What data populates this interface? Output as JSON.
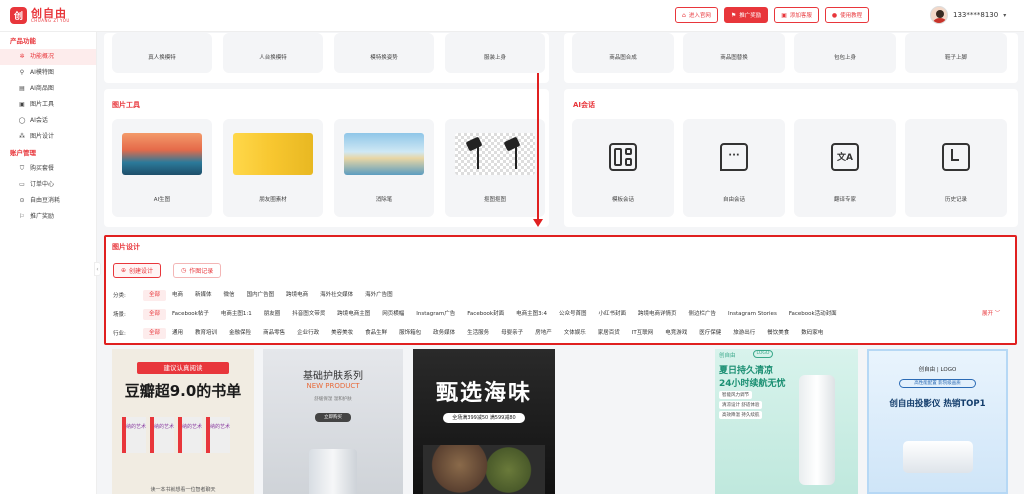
{
  "app": {
    "logo_mark": "创",
    "logo_cn": "创自由",
    "logo_en": "CHUANG ZI YOU"
  },
  "top_buttons": [
    {
      "label": "进入官网",
      "icon": "home-icon",
      "filled": false
    },
    {
      "label": "推广奖励",
      "icon": "flag-icon",
      "filled": true
    },
    {
      "label": "添加客服",
      "icon": "gift-icon",
      "filled": false
    },
    {
      "label": "使用教程",
      "icon": "play-icon",
      "filled": false
    }
  ],
  "user": {
    "phone": "133****8130",
    "caret": "▾"
  },
  "sidebar": {
    "section1": "产品功能",
    "items1": [
      {
        "label": "功能概况",
        "icon": "✲",
        "active": true
      },
      {
        "label": "AI模特图",
        "icon": "⚲"
      },
      {
        "label": "AI商品图",
        "icon": "▤"
      },
      {
        "label": "图片工具",
        "icon": "▣"
      },
      {
        "label": "AI会话",
        "icon": "◯"
      },
      {
        "label": "图片设计",
        "icon": "⁂"
      }
    ],
    "section2": "账户管理",
    "items2": [
      {
        "label": "购买套餐",
        "icon": "⛉"
      },
      {
        "label": "订单中心",
        "icon": "▭"
      },
      {
        "label": "自由豆消耗",
        "icon": "⊙"
      },
      {
        "label": "推广奖励",
        "icon": "⚐"
      }
    ],
    "collapse": "‹"
  },
  "top_tiles_left": [
    "真人换模特",
    "人台换模特",
    "模特换姿势",
    "服装上身"
  ],
  "top_tiles_right": [
    "商品图合成",
    "商品图替换",
    "包包上身",
    "鞋子上脚"
  ],
  "image_tools": {
    "title": "图片工具",
    "tiles": [
      "AI生图",
      "朋友圈素材",
      "消除笔",
      "抠图抠图"
    ]
  },
  "ai_chat": {
    "title": "AI会话",
    "tiles": [
      {
        "label": "模板会话",
        "glyph": "▯▤"
      },
      {
        "label": "自由会话",
        "glyph": "⋯"
      },
      {
        "label": "翻译专家",
        "glyph": "文A"
      },
      {
        "label": "历史记录",
        "glyph": "L"
      }
    ]
  },
  "design": {
    "title": "图片设计",
    "create_btn": "创建设计",
    "record_btn": "作图记录",
    "expand": "展开 ﹀",
    "rows": [
      {
        "label": "分类:",
        "chips": [
          "全部",
          "电商",
          "新媒体",
          "微信",
          "国内广告图",
          "跨境电商",
          "海外社交媒体",
          "海外广告图"
        ]
      },
      {
        "label": "场景:",
        "chips": [
          "全部",
          "Facebook帖子",
          "电商主图1:1",
          "朋友圈",
          "抖音图文带货",
          "跨境电商主图",
          "网页横幅",
          "Instagram广告",
          "Facebook封面",
          "电商主图3:4",
          "公众号首图",
          "小红书封面",
          "跨境电商详情页",
          "侧边栏广告",
          "Instagram Stories",
          "Facebook活动封面"
        ]
      },
      {
        "label": "行业:",
        "chips": [
          "全部",
          "通用",
          "教育培训",
          "金融保险",
          "商品零售",
          "企业行政",
          "美容美妆",
          "食品生鲜",
          "服饰箱包",
          "政务媒体",
          "生活服务",
          "母婴亲子",
          "房地产",
          "文体娱乐",
          "家居百货",
          "IT互联网",
          "电竞游戏",
          "医疗保健",
          "旅游出行",
          "餐饮美食",
          "数码家电"
        ]
      }
    ]
  },
  "templates": [
    {
      "banner": "建议认真阅读",
      "title": "豆瓣超9.0的书单",
      "book": "纳的艺术",
      "foot": "读一本书就想看一位智者聊天"
    },
    {
      "title": "基础护肤系列",
      "sub": "NEW PRODUCT",
      "desc": "舒缓保湿 温和护肤",
      "btn": "立即购买"
    },
    {
      "title": "甄选海味",
      "promo": "全场满399减50 满599减80"
    },
    {
      "brand": "创自由",
      "logo": "LOGO",
      "title": "夏日持久清凉",
      "sub": "24小时续航无忧",
      "f1": "智能风力调节",
      "f2": "清凉设计 舒适体验",
      "f3": "高效降温 持久续航"
    },
    {
      "brand": "创自由 | LOGO",
      "badge": "高性能配置 影院级画质",
      "title": "创自由投影仪 热销TOP1"
    }
  ]
}
